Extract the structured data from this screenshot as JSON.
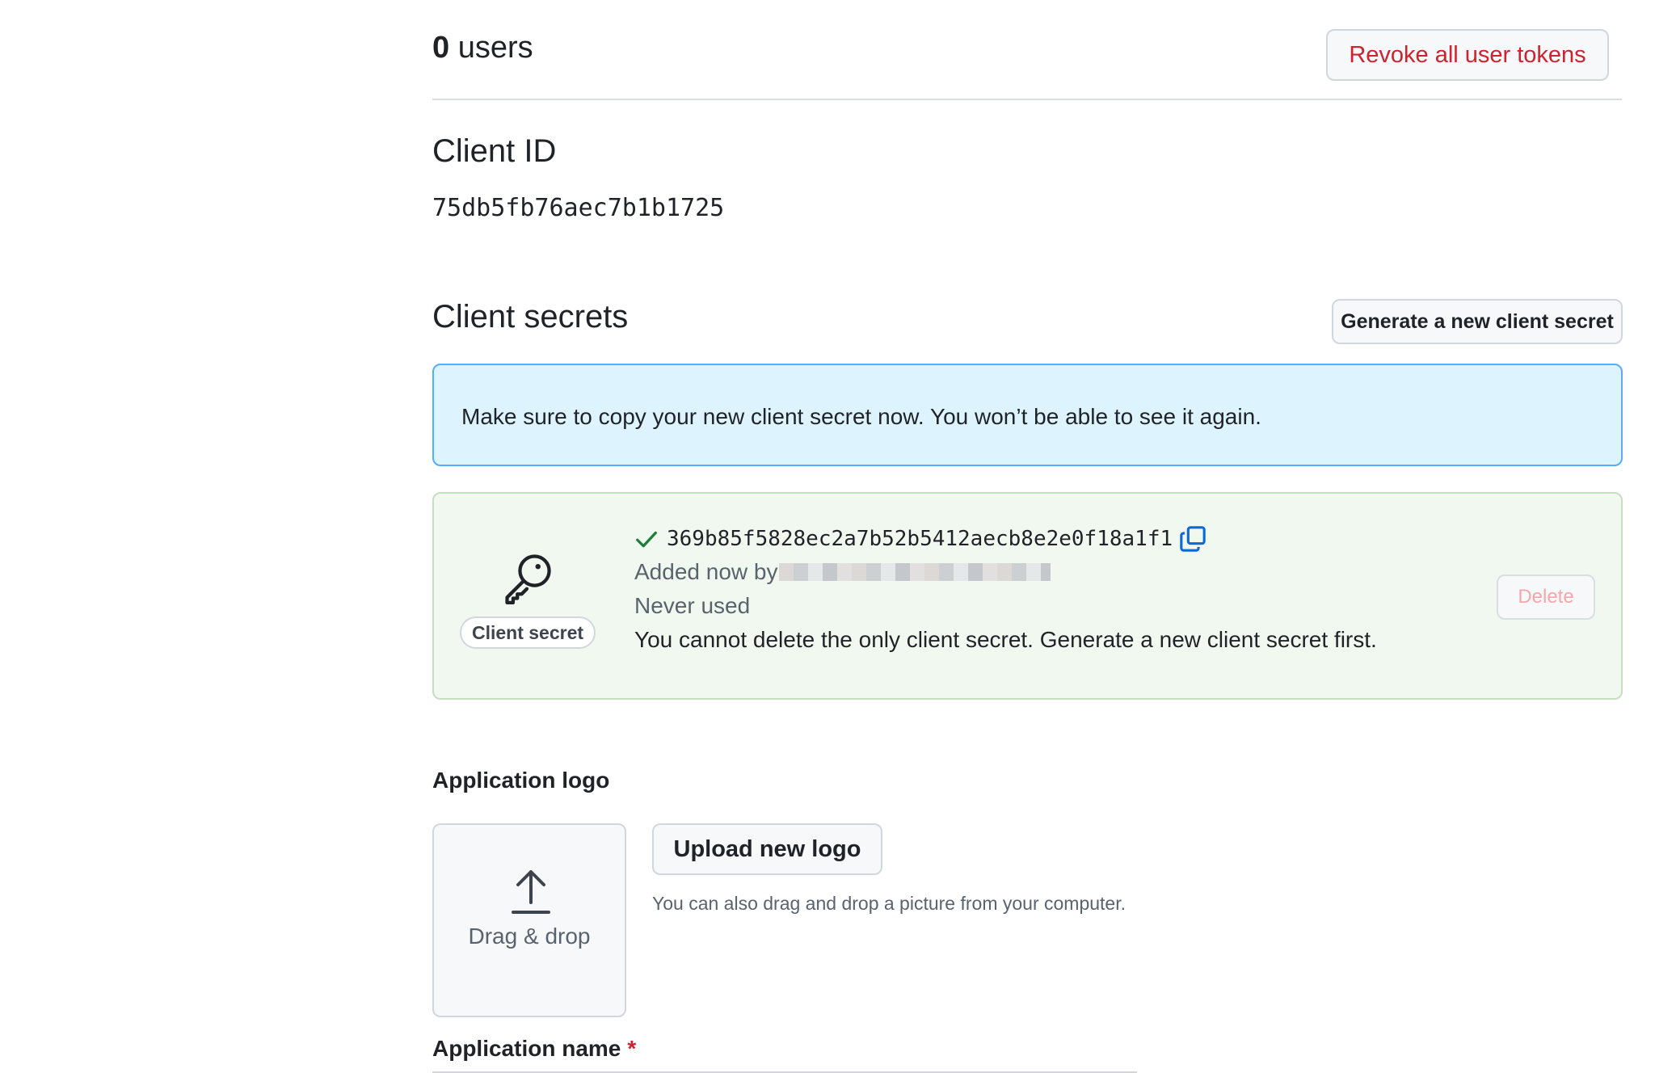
{
  "users": {
    "count": "0",
    "label": "users",
    "revoke_button": "Revoke all user tokens"
  },
  "client_id": {
    "title": "Client ID",
    "value": "75db5fb76aec7b1b1725"
  },
  "client_secrets": {
    "title": "Client secrets",
    "generate_button": "Generate a new client secret",
    "flash_message": "Make sure to copy your new client secret now. You won’t be able to see it again.",
    "secret": {
      "label": "Client secret",
      "value": "369b85f5828ec2a7b52b5412aecb8e2e0f18a1f1",
      "added": "Added now by",
      "usage": "Never used",
      "warning": "You cannot delete the only client secret. Generate a new client secret first.",
      "delete_button": "Delete"
    }
  },
  "logo": {
    "heading": "Application logo",
    "dropzone_text": "Drag & drop",
    "upload_button": "Upload new logo",
    "hint": "You can also drag and drop a picture from your computer."
  },
  "app_name": {
    "heading": "Application name",
    "required_mark": "*"
  },
  "colors": {
    "danger": "#cf222e",
    "info_bg": "#ddf4ff",
    "info_border": "#54aeff",
    "success_bg": "#f1f8ef",
    "success_check": "#1a7f37",
    "link_blue": "#0969da"
  },
  "icons": {
    "key": "key-icon",
    "check": "check-icon",
    "copy": "copy-icon",
    "upload": "upload-icon"
  }
}
